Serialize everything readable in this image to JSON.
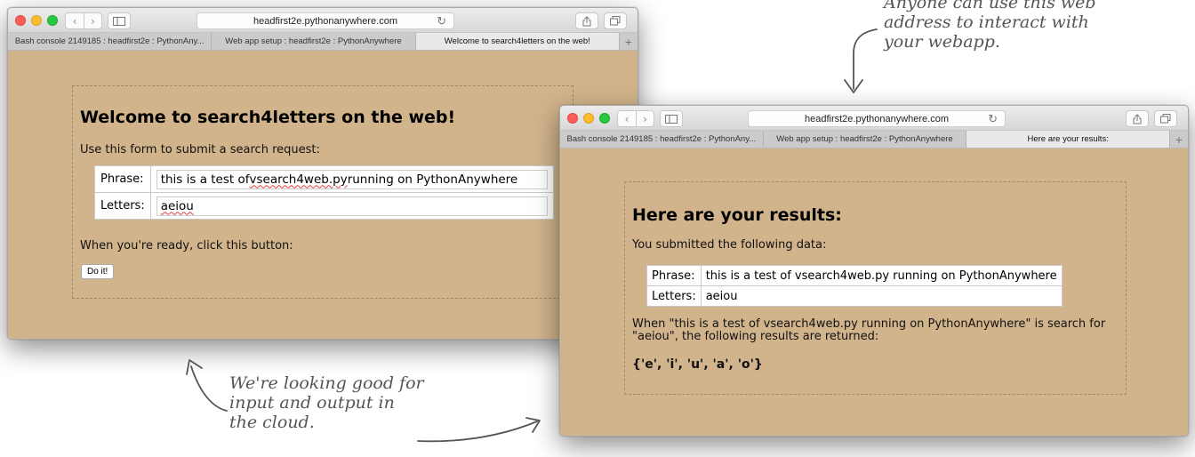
{
  "left_window": {
    "url": "headfirst2e.pythonanywhere.com",
    "tabs": [
      "Bash console 2149185 : headfirst2e : PythonAny...",
      "Web app setup : headfirst2e : PythonAnywhere",
      "Welcome to search4letters on the web!"
    ],
    "heading": "Welcome to search4letters on the web!",
    "intro": "Use this form to submit a search request:",
    "phrase_label": "Phrase:",
    "phrase_value_prefix": "this is a test of ",
    "phrase_value_misspelled": "vsearch4web.py",
    "phrase_value_suffix": " running on PythonAnywhere",
    "letters_label": "Letters:",
    "letters_value": "aeiou",
    "ready_text": "When you're ready, click this button:",
    "button_label": "Do it!"
  },
  "right_window": {
    "url": "headfirst2e.pythonanywhere.com",
    "tabs": [
      "Bash console 2149185 : headfirst2e : PythonAny...",
      "Web app setup : headfirst2e : PythonAnywhere",
      "Here are your results:"
    ],
    "heading": "Here are your results:",
    "intro": "You submitted the following data:",
    "phrase_label": "Phrase:",
    "phrase_value": "this is a test of vsearch4web.py running on PythonAnywhere",
    "letters_label": "Letters:",
    "letters_value": "aeiou",
    "result_sentence_line1": "When \"this is a test of vsearch4web.py running on PythonAnywhere\" is search for",
    "result_sentence_line2": "\"aeiou\", the following results are returned:",
    "results": "{'e', 'i', 'u', 'a', 'o'}"
  },
  "annotations": {
    "top_note_lines": [
      "Anyone can use this web",
      "address to interact with",
      "your webapp."
    ],
    "bottom_note_lines": [
      "We're looking good for",
      "input and output in",
      "the cloud."
    ]
  },
  "icons": {
    "back": "chevron-left-icon",
    "forward": "chevron-right-icon",
    "sidebar": "sidebar-icon",
    "reload": "reload-icon",
    "share": "share-icon",
    "tabs": "tabs-overview-icon",
    "new_tab": "plus-icon"
  }
}
